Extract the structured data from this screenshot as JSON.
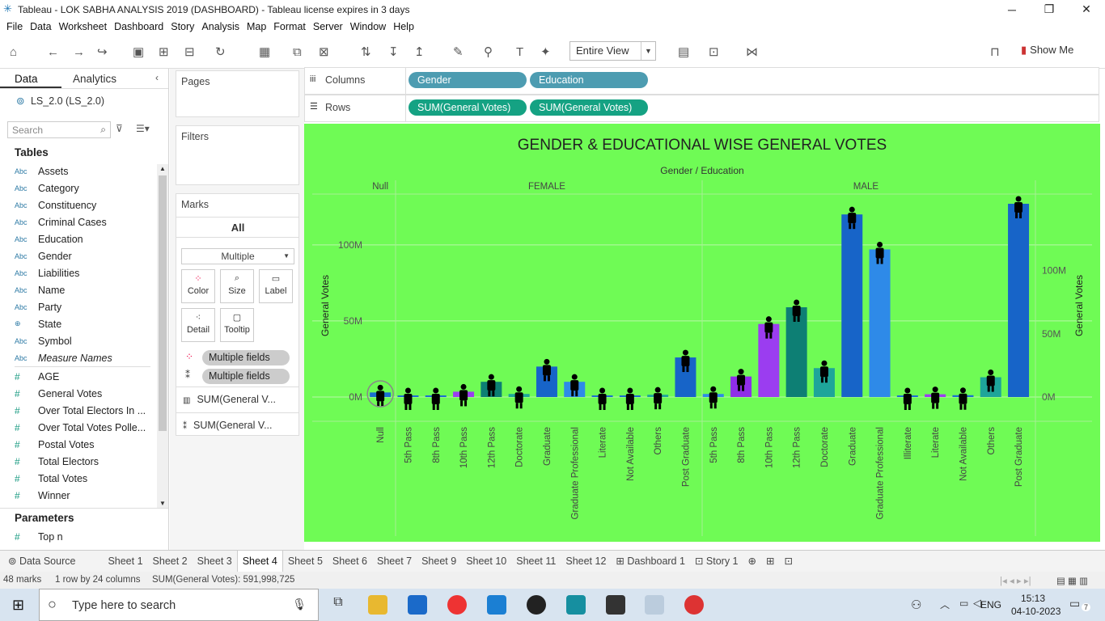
{
  "window": {
    "title": "Tableau - LOK SABHA ANALYSIS 2019 (DASHBOARD) - Tableau license expires in 3 days"
  },
  "menu": [
    "File",
    "Data",
    "Worksheet",
    "Dashboard",
    "Story",
    "Analysis",
    "Map",
    "Format",
    "Server",
    "Window",
    "Help"
  ],
  "toolbar": {
    "fit": "Entire View",
    "show_me": "Show Me"
  },
  "left_pane": {
    "tab_data": "Data",
    "tab_analytics": "Analytics",
    "datasource": "LS_2.0 (LS_2.0)",
    "search_placeholder": "Search",
    "tables_header": "Tables",
    "dimensions": [
      "Assets",
      "Category",
      "Constituency",
      "Criminal Cases",
      "Education",
      "Gender",
      "Liabilities",
      "Name",
      "Party",
      "State",
      "Symbol",
      "Measure Names"
    ],
    "measures": [
      "AGE",
      "General Votes",
      "Over Total Electors  In ...",
      "Over Total Votes Polle...",
      "Postal Votes",
      "Total Electors",
      "Total Votes",
      "Winner"
    ],
    "dim_type_label": "Abc",
    "num_type_label": "#",
    "params_header": "Parameters",
    "parameters": [
      "Top n"
    ]
  },
  "shelves": {
    "pages": "Pages",
    "filters": "Filters",
    "marks": "Marks",
    "marks_all": "All",
    "mark_type": "Multiple",
    "mark_buttons": [
      "Color",
      "Size",
      "Label",
      "Detail",
      "Tooltip"
    ],
    "mark_fields": [
      "Multiple fields",
      "Multiple fields"
    ],
    "sum_rows": [
      "SUM(General V...",
      "SUM(General V..."
    ],
    "columns_label": "Columns",
    "rows_label": "Rows",
    "columns": [
      "Gender",
      "Education"
    ],
    "rows": [
      "SUM(General Votes)",
      "SUM(General Votes)"
    ]
  },
  "chart_data": {
    "type": "bar",
    "title": "GENDER & EDUCATIONAL WISE  GENERAL VOTES",
    "header": "Gender / Education",
    "ylabel": "General Votes",
    "ylim": [
      0,
      125000000
    ],
    "yticks": [
      "0M",
      "50M",
      "100M"
    ],
    "y2ticks": [
      "0M",
      "50M",
      "100M"
    ],
    "groups": [
      "Null",
      "FEMALE",
      "MALE"
    ],
    "categories": [
      {
        "group": "Null",
        "label": "Null",
        "value": 3000000,
        "color": "#1a6fd0"
      },
      {
        "group": "FEMALE",
        "label": "5th Pass",
        "value": 600000,
        "color": "#1a6fd0"
      },
      {
        "group": "FEMALE",
        "label": "8th Pass",
        "value": 600000,
        "color": "#1a6fd0"
      },
      {
        "group": "FEMALE",
        "label": "10th Pass",
        "value": 3500000,
        "color": "#9b3df0"
      },
      {
        "group": "FEMALE",
        "label": "12th Pass",
        "value": 10000000,
        "color": "#0d7f74"
      },
      {
        "group": "FEMALE",
        "label": "Doctorate",
        "value": 2000000,
        "color": "#1ea59a"
      },
      {
        "group": "FEMALE",
        "label": "Graduate",
        "value": 20000000,
        "color": "#1764c8"
      },
      {
        "group": "FEMALE",
        "label": "Graduate Professional",
        "value": 10000000,
        "color": "#2e8ae8"
      },
      {
        "group": "FEMALE",
        "label": "Literate",
        "value": 300000,
        "color": "#1a6fd0"
      },
      {
        "group": "FEMALE",
        "label": "Not Available",
        "value": 300000,
        "color": "#1a6fd0"
      },
      {
        "group": "FEMALE",
        "label": "Others",
        "value": 1500000,
        "color": "#1ea59a"
      },
      {
        "group": "FEMALE",
        "label": "Post Graduate",
        "value": 26000000,
        "color": "#1764c8"
      },
      {
        "group": "MALE",
        "label": "5th Pass",
        "value": 2000000,
        "color": "#2e8ae8"
      },
      {
        "group": "MALE",
        "label": "8th Pass",
        "value": 13500000,
        "color": "#8f2ee8"
      },
      {
        "group": "MALE",
        "label": "10th Pass",
        "value": 48000000,
        "color": "#9b3df0"
      },
      {
        "group": "MALE",
        "label": "12th Pass",
        "value": 59000000,
        "color": "#0d7f74"
      },
      {
        "group": "MALE",
        "label": "Doctorate",
        "value": 19000000,
        "color": "#1ea59a"
      },
      {
        "group": "MALE",
        "label": "Graduate",
        "value": 120000000,
        "color": "#1764c8"
      },
      {
        "group": "MALE",
        "label": "Graduate Professional",
        "value": 97000000,
        "color": "#2e8ae8"
      },
      {
        "group": "MALE",
        "label": "Illiterate",
        "value": 600000,
        "color": "#1a6fd0"
      },
      {
        "group": "MALE",
        "label": "Literate",
        "value": 1800000,
        "color": "#9b3df0"
      },
      {
        "group": "MALE",
        "label": "Not Available",
        "value": 1200000,
        "color": "#1a6fd0"
      },
      {
        "group": "MALE",
        "label": "Others",
        "value": 13000000,
        "color": "#1ea59a"
      },
      {
        "group": "MALE",
        "label": "Post Graduate",
        "value": 127000000,
        "color": "#1764c8"
      }
    ],
    "background": "#6ffb55",
    "grid": true
  },
  "sheet_tabs": [
    "Data Source",
    "Sheet 1",
    "Sheet 2",
    "Sheet 3",
    "Sheet 4",
    "Sheet 5",
    "Sheet 6",
    "Sheet 7",
    "Sheet 9",
    "Sheet 10",
    "Sheet 11",
    "Sheet 12",
    "Dashboard 1",
    "Story 1"
  ],
  "active_sheet": "Sheet 4",
  "status": {
    "marks": "48 marks",
    "rows": "1 row by 24 columns",
    "sum": "SUM(General Votes): 591,998,725"
  },
  "taskbar": {
    "search_placeholder": "Type here to search",
    "lang": "ENG",
    "time": "15:13",
    "date": "04-10-2023",
    "notif": "7"
  }
}
